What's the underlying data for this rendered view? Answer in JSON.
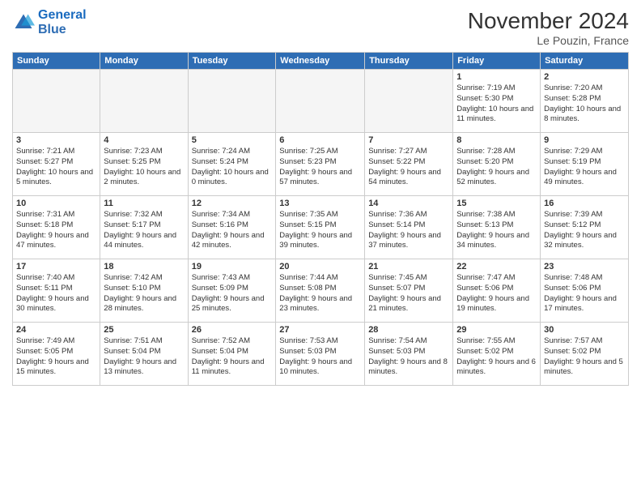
{
  "header": {
    "logo_line1": "General",
    "logo_line2": "Blue",
    "month_title": "November 2024",
    "subtitle": "Le Pouzin, France"
  },
  "weekdays": [
    "Sunday",
    "Monday",
    "Tuesday",
    "Wednesday",
    "Thursday",
    "Friday",
    "Saturday"
  ],
  "weeks": [
    [
      {
        "day": "",
        "info": ""
      },
      {
        "day": "",
        "info": ""
      },
      {
        "day": "",
        "info": ""
      },
      {
        "day": "",
        "info": ""
      },
      {
        "day": "",
        "info": ""
      },
      {
        "day": "1",
        "info": "Sunrise: 7:19 AM\nSunset: 5:30 PM\nDaylight: 10 hours and 11 minutes."
      },
      {
        "day": "2",
        "info": "Sunrise: 7:20 AM\nSunset: 5:28 PM\nDaylight: 10 hours and 8 minutes."
      }
    ],
    [
      {
        "day": "3",
        "info": "Sunrise: 7:21 AM\nSunset: 5:27 PM\nDaylight: 10 hours and 5 minutes."
      },
      {
        "day": "4",
        "info": "Sunrise: 7:23 AM\nSunset: 5:25 PM\nDaylight: 10 hours and 2 minutes."
      },
      {
        "day": "5",
        "info": "Sunrise: 7:24 AM\nSunset: 5:24 PM\nDaylight: 10 hours and 0 minutes."
      },
      {
        "day": "6",
        "info": "Sunrise: 7:25 AM\nSunset: 5:23 PM\nDaylight: 9 hours and 57 minutes."
      },
      {
        "day": "7",
        "info": "Sunrise: 7:27 AM\nSunset: 5:22 PM\nDaylight: 9 hours and 54 minutes."
      },
      {
        "day": "8",
        "info": "Sunrise: 7:28 AM\nSunset: 5:20 PM\nDaylight: 9 hours and 52 minutes."
      },
      {
        "day": "9",
        "info": "Sunrise: 7:29 AM\nSunset: 5:19 PM\nDaylight: 9 hours and 49 minutes."
      }
    ],
    [
      {
        "day": "10",
        "info": "Sunrise: 7:31 AM\nSunset: 5:18 PM\nDaylight: 9 hours and 47 minutes."
      },
      {
        "day": "11",
        "info": "Sunrise: 7:32 AM\nSunset: 5:17 PM\nDaylight: 9 hours and 44 minutes."
      },
      {
        "day": "12",
        "info": "Sunrise: 7:34 AM\nSunset: 5:16 PM\nDaylight: 9 hours and 42 minutes."
      },
      {
        "day": "13",
        "info": "Sunrise: 7:35 AM\nSunset: 5:15 PM\nDaylight: 9 hours and 39 minutes."
      },
      {
        "day": "14",
        "info": "Sunrise: 7:36 AM\nSunset: 5:14 PM\nDaylight: 9 hours and 37 minutes."
      },
      {
        "day": "15",
        "info": "Sunrise: 7:38 AM\nSunset: 5:13 PM\nDaylight: 9 hours and 34 minutes."
      },
      {
        "day": "16",
        "info": "Sunrise: 7:39 AM\nSunset: 5:12 PM\nDaylight: 9 hours and 32 minutes."
      }
    ],
    [
      {
        "day": "17",
        "info": "Sunrise: 7:40 AM\nSunset: 5:11 PM\nDaylight: 9 hours and 30 minutes."
      },
      {
        "day": "18",
        "info": "Sunrise: 7:42 AM\nSunset: 5:10 PM\nDaylight: 9 hours and 28 minutes."
      },
      {
        "day": "19",
        "info": "Sunrise: 7:43 AM\nSunset: 5:09 PM\nDaylight: 9 hours and 25 minutes."
      },
      {
        "day": "20",
        "info": "Sunrise: 7:44 AM\nSunset: 5:08 PM\nDaylight: 9 hours and 23 minutes."
      },
      {
        "day": "21",
        "info": "Sunrise: 7:45 AM\nSunset: 5:07 PM\nDaylight: 9 hours and 21 minutes."
      },
      {
        "day": "22",
        "info": "Sunrise: 7:47 AM\nSunset: 5:06 PM\nDaylight: 9 hours and 19 minutes."
      },
      {
        "day": "23",
        "info": "Sunrise: 7:48 AM\nSunset: 5:06 PM\nDaylight: 9 hours and 17 minutes."
      }
    ],
    [
      {
        "day": "24",
        "info": "Sunrise: 7:49 AM\nSunset: 5:05 PM\nDaylight: 9 hours and 15 minutes."
      },
      {
        "day": "25",
        "info": "Sunrise: 7:51 AM\nSunset: 5:04 PM\nDaylight: 9 hours and 13 minutes."
      },
      {
        "day": "26",
        "info": "Sunrise: 7:52 AM\nSunset: 5:04 PM\nDaylight: 9 hours and 11 minutes."
      },
      {
        "day": "27",
        "info": "Sunrise: 7:53 AM\nSunset: 5:03 PM\nDaylight: 9 hours and 10 minutes."
      },
      {
        "day": "28",
        "info": "Sunrise: 7:54 AM\nSunset: 5:03 PM\nDaylight: 9 hours and 8 minutes."
      },
      {
        "day": "29",
        "info": "Sunrise: 7:55 AM\nSunset: 5:02 PM\nDaylight: 9 hours and 6 minutes."
      },
      {
        "day": "30",
        "info": "Sunrise: 7:57 AM\nSunset: 5:02 PM\nDaylight: 9 hours and 5 minutes."
      }
    ]
  ]
}
